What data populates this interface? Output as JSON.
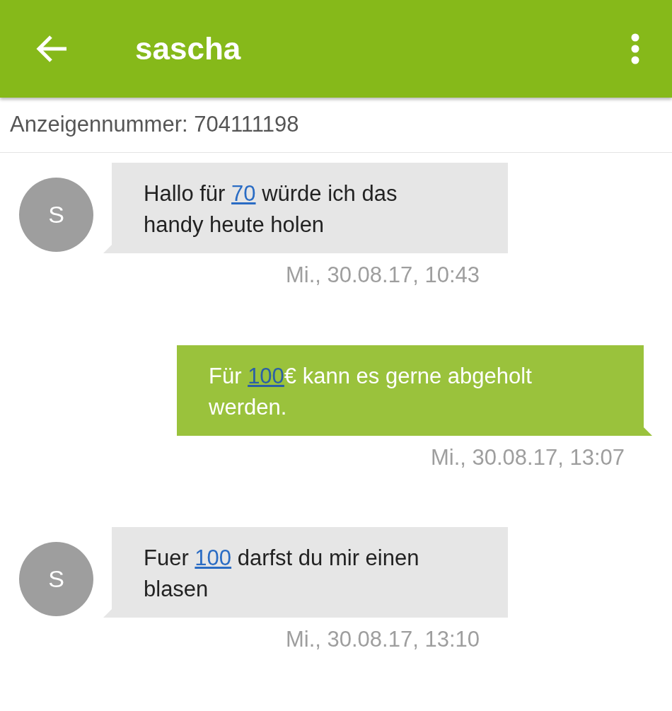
{
  "header": {
    "title": "sascha"
  },
  "ad_number": "Anzeigennummer: 704111198",
  "messages": [
    {
      "kind": "incoming",
      "avatar": "S",
      "parts": [
        {
          "kind": "text",
          "text": "Hallo für "
        },
        {
          "kind": "link",
          "text": "70"
        },
        {
          "kind": "text",
          "text": " würde ich das handy heute holen"
        }
      ],
      "time": "Mi., 30.08.17, 10:43"
    },
    {
      "kind": "outgoing",
      "parts": [
        {
          "kind": "text",
          "text": "Für "
        },
        {
          "kind": "link",
          "text": "100"
        },
        {
          "kind": "text",
          "text": "€ kann es gerne abgeholt werden."
        }
      ],
      "time": "Mi., 30.08.17, 13:07"
    },
    {
      "kind": "incoming",
      "avatar": "S",
      "parts": [
        {
          "kind": "text",
          "text": "Fuer "
        },
        {
          "kind": "link",
          "text": "100"
        },
        {
          "kind": "text",
          "text": " darfst du mir einen blasen"
        }
      ],
      "time": "Mi., 30.08.17, 13:10"
    }
  ]
}
